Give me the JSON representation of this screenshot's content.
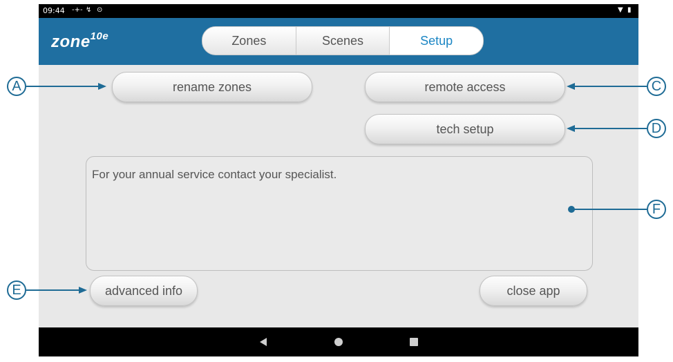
{
  "status_bar": {
    "time": "09:44",
    "icons": [
      "signal-icon",
      "usb-icon",
      "alarm-icon",
      "wifi-icon",
      "battery-icon"
    ]
  },
  "app": {
    "logo_text": "zone",
    "logo_superscript": "10e"
  },
  "tabs": [
    {
      "label": "Zones",
      "active": false
    },
    {
      "label": "Scenes",
      "active": false
    },
    {
      "label": "Setup",
      "active": true
    }
  ],
  "buttons": {
    "rename_zones": "rename zones",
    "remote_access": "remote access",
    "tech_setup": "tech setup",
    "advanced_info": "advanced info",
    "close_app": "close app"
  },
  "info_box": {
    "text": "For your annual service contact your specialist."
  },
  "callouts": {
    "a": "A",
    "c": "C",
    "d": "D",
    "e": "E",
    "f": "F"
  },
  "colors": {
    "brand_bar": "#1f6fa1",
    "active_tab_text": "#1b86c4",
    "callout": "#1e6b95"
  }
}
